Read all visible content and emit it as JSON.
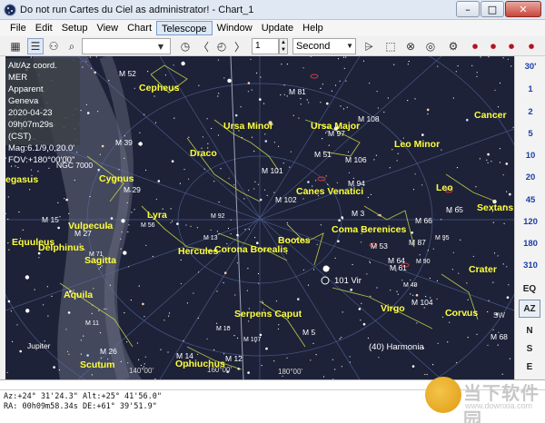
{
  "window": {
    "title": "Do not run Cartes du Ciel as administrator! - Chart_1"
  },
  "menu": [
    "File",
    "Edit",
    "Setup",
    "View",
    "Chart",
    "Telescope",
    "Window",
    "Update",
    "Help"
  ],
  "toolbar": {
    "search_value": "",
    "step_value": "1",
    "time_unit": "Second"
  },
  "info_panel": [
    "Alt/Az coord. MER",
    "Apparent",
    "Geneva",
    "2020-04-23",
    "09h07m29s (CST)",
    "Mag:6.1/9.0,20.0'",
    "FOV:+180°00'00\""
  ],
  "fov_buttons": [
    "30'",
    "1",
    "2",
    "5",
    "10",
    "20",
    "45",
    "120",
    "180",
    "310"
  ],
  "right_buttons": [
    "EQ",
    "AZ",
    "N",
    "S",
    "E"
  ],
  "status": {
    "line1": "Az:+24° 31'24.3\" Alt:+25° 41'56.0\"",
    "line2": "RA: 00h09m58.34s DE:+61° 39'51.9\""
  },
  "watermark": {
    "text": "当下软件园",
    "url": "www.downxia.com"
  },
  "colors": {
    "sky": "#1d2238",
    "constellation_line": "#c9d84a",
    "label": "#ffff3a",
    "fov_label": "#1a3fa8"
  },
  "sky_labels": {
    "constellations": [
      "Cepheus",
      "Ursa Minor",
      "Ursa Major",
      "Cancer",
      "Draco",
      "Cygnus",
      "Leo Minor",
      "Canes Venatici",
      "Leo",
      "Lyra",
      "Vulpecula",
      "Sextans",
      "Coma Berenices",
      "Hercules",
      "Corona Borealis",
      "Bootes",
      "Delphinus",
      "Equuleus",
      "Sagitta",
      "Aquila",
      "Virgo",
      "Crater",
      "Corvus",
      "Serpens Caput",
      "Ophiuchus",
      "Scutum",
      "egasus",
      "Jupiter"
    ],
    "objects": [
      "M 52",
      "M 81",
      "M 108",
      "M 39",
      "M 97",
      "NGC 7000",
      "M 101",
      "M 106",
      "M 51",
      "M 94",
      "M 29",
      "M 102",
      "M 3",
      "M 66",
      "M 65",
      "M 15",
      "M 27",
      "M 53",
      "M 87",
      "M 64",
      "M 61",
      "M 104",
      "M 5",
      "M 68",
      "M 14",
      "M 26",
      "M 12",
      "101 Vir",
      "(40) Harmonia",
      "M 56",
      "M 92",
      "M 13",
      "M 71",
      "M 95",
      "M 90",
      "M 49",
      "M 11",
      "M 10",
      "M 107"
    ],
    "ra_marks": [
      "140°00'",
      "160°00'",
      "180°00'"
    ],
    "compass": [
      "SW"
    ]
  }
}
